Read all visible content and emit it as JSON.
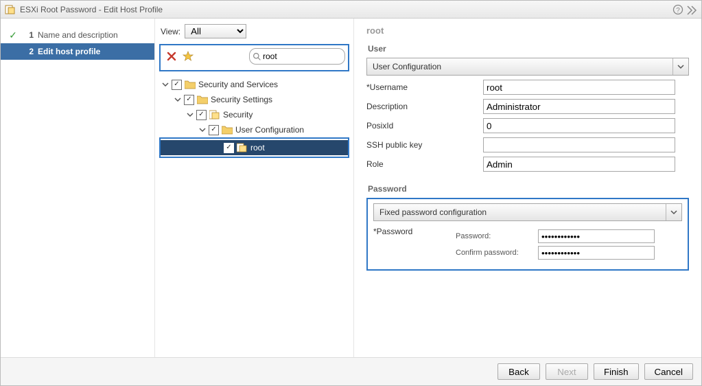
{
  "window": {
    "title": "ESXi Root Password - Edit Host Profile"
  },
  "steps": {
    "s1": {
      "num": "1",
      "label": "Name and description"
    },
    "s2": {
      "num": "2",
      "label": "Edit host profile"
    }
  },
  "view": {
    "label": "View:",
    "selected": "All"
  },
  "search": {
    "value": "root"
  },
  "tree": {
    "n1": "Security and Services",
    "n2": "Security Settings",
    "n3": "Security",
    "n4": "User Configuration",
    "n5": "root"
  },
  "panel": {
    "title": "root",
    "user_section": "User",
    "combo1": "User Configuration",
    "fields": {
      "username_label": "*Username",
      "username_value": "root",
      "description_label": "Description",
      "description_value": "Administrator",
      "posix_label": "PosixId",
      "posix_value": "0",
      "ssh_label": "SSH public key",
      "ssh_value": "",
      "role_label": "Role",
      "role_value": "Admin"
    },
    "pw_section": "Password",
    "combo2": "Fixed password configuration",
    "pw_label": "*Password",
    "pw_field_label": "Password:",
    "pw_confirm_label": "Confirm password:",
    "pw_value": "************",
    "pw_confirm_value": "************"
  },
  "buttons": {
    "back": "Back",
    "next": "Next",
    "finish": "Finish",
    "cancel": "Cancel"
  }
}
